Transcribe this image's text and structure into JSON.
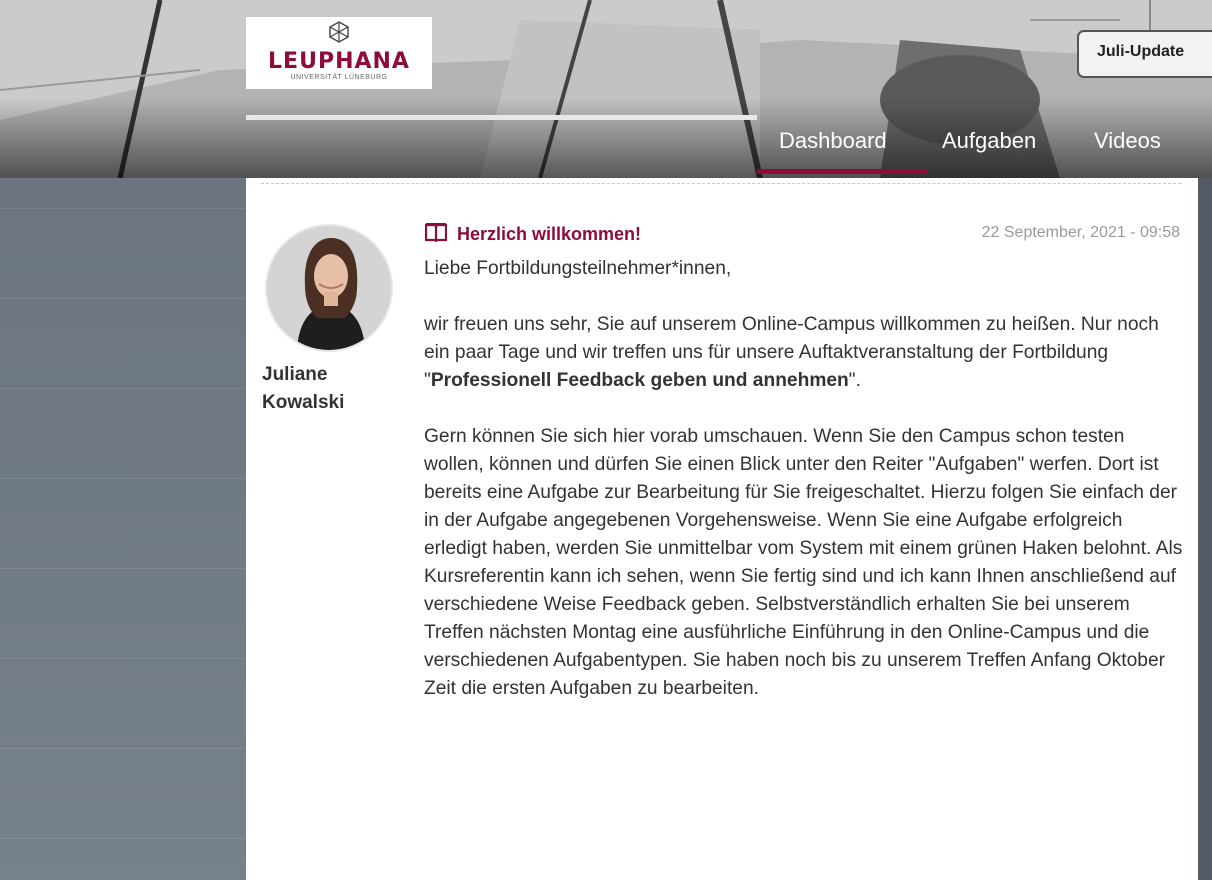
{
  "header": {
    "logo": {
      "name": "LEUPHANA",
      "subtitle": "UNIVERSITÄT LÜNEBURG"
    },
    "update_button": "Juli-Update",
    "nav": [
      {
        "label": "Dashboard",
        "active": true
      },
      {
        "label": "Aufgaben",
        "active": false
      },
      {
        "label": "Videos",
        "active": false
      }
    ]
  },
  "post": {
    "author_first": "Juliane",
    "author_last": "Kowalski",
    "title": "Herzlich willkommen!",
    "date": "22 September, 2021 - 09:58",
    "greeting": "Liebe Fortbildungsteilnehmer*innen,",
    "p2_pre": "wir freuen uns sehr, Sie auf unserem Online-Campus willkommen zu heißen. Nur noch ein paar Tage und wir treffen uns für unsere Auftaktveranstaltung der Fortbildung \"",
    "p2_bold": "Professionell Feedback geben und annehmen",
    "p2_post": "\".",
    "p3": "Gern können Sie sich hier vorab umschauen. Wenn Sie den Campus schon testen wollen, können und dürfen Sie einen Blick unter den Reiter \"Aufgaben\" werfen. Dort ist bereits eine Aufgabe zur Bearbeitung für Sie freigeschaltet. Hierzu folgen Sie einfach der in der Aufgabe angegebenen Vorgehensweise. Wenn Sie eine Aufgabe erfolgreich erledigt haben, werden Sie unmittelbar vom System mit einem grünen Haken belohnt. Als Kursreferentin kann ich sehen, wenn Sie fertig sind und ich kann Ihnen anschließend auf verschiedene Weise Feedback geben. Selbstverständlich erhalten Sie bei unserem Treffen nächsten Montag eine ausführliche Einführung in den Online-Campus und die verschiedenen Aufgabentypen. Sie haben noch bis zu unserem Treffen Anfang Oktober Zeit die ersten Aufgaben zu bearbeiten."
  },
  "colors": {
    "brand": "#8e0b3b",
    "text": "#333333",
    "date": "#9a9a9a"
  },
  "icons": {
    "post_icon": "open-book-icon",
    "logo_symbol": "hexagon-cube-logo-icon"
  }
}
